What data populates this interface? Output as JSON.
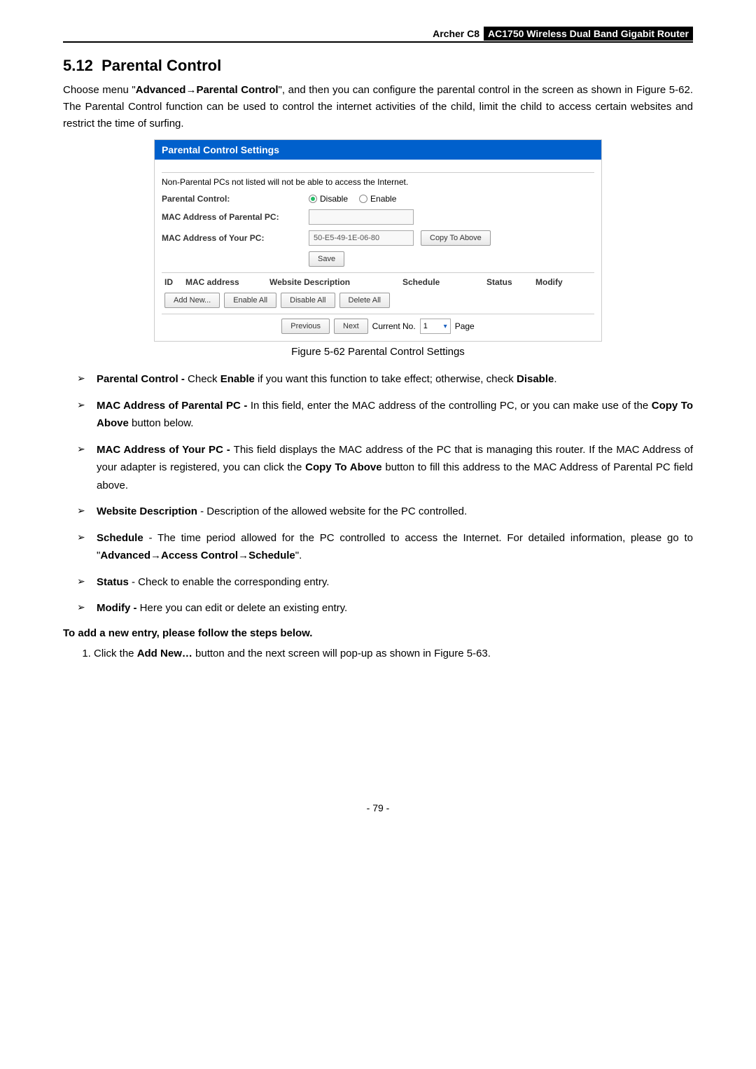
{
  "header": {
    "model": "Archer C8",
    "desc": "AC1750 Wireless Dual Band Gigabit Router"
  },
  "section": {
    "number": "5.12",
    "title": "Parental Control"
  },
  "intro": {
    "pre": "Choose menu \"",
    "b1": "Advanced",
    "arrow": "→",
    "b2": "Parental Control",
    "post": "\", and then you can configure the parental control in the screen as shown in Figure 5-62. The Parental Control function can be used to control the internet activities of the child, limit the child to access certain websites and restrict the time of surfing."
  },
  "ui": {
    "panel_title": "Parental Control Settings",
    "note": "Non-Parental PCs not listed will not be able to access the Internet.",
    "labels": {
      "parental_control": "Parental Control:",
      "mac_parental": "MAC Address of Parental PC:",
      "mac_your": "MAC Address of Your PC:"
    },
    "radio": {
      "disable": "Disable",
      "enable": "Enable"
    },
    "mac_your_value": "50-E5-49-1E-06-80",
    "buttons": {
      "copy": "Copy To Above",
      "save": "Save",
      "add": "Add New...",
      "enable_all": "Enable All",
      "disable_all": "Disable All",
      "delete_all": "Delete All",
      "previous": "Previous",
      "next": "Next"
    },
    "table": {
      "id": "ID",
      "mac": "MAC address",
      "web": "Website Description",
      "schedule": "Schedule",
      "status": "Status",
      "modify": "Modify"
    },
    "pager": {
      "current_no": "Current No.",
      "value": "1",
      "page": "Page"
    }
  },
  "caption": "Figure 5-62 Parental Control Settings",
  "bullets": {
    "b1": {
      "t1": "Parental Control - ",
      "t2": "Check ",
      "t3": "Enable",
      "t4": " if you want this function to take effect; otherwise, check ",
      "t5": "Disable",
      "t6": "."
    },
    "b2": {
      "t1": "MAC Address of Parental PC - ",
      "t2": "In this field, enter the MAC address of the controlling PC, or you can make use of the ",
      "t3": "Copy To Above",
      "t4": " button below."
    },
    "b3": {
      "t1": "MAC Address of Your PC - ",
      "t2": "This field displays the MAC address of the PC that is managing this router. If the MAC Address of your adapter is registered, you can click the ",
      "t3": "Copy To Above",
      "t4": " button to fill this address to the MAC Address of Parental PC field above."
    },
    "b4": {
      "t1": "Website Description",
      "t2": " - Description of the allowed website for the PC controlled."
    },
    "b5": {
      "t1": "Schedule",
      "t2": " - The time period allowed for the PC controlled to access the Internet. For detailed information, please go to \"",
      "t3": "Advanced",
      "t4": "→",
      "t5": "Access Control",
      "t6": "→",
      "t7": "Schedule",
      "t8": "\"."
    },
    "b6": {
      "t1": "Status",
      "t2": " - Check to enable the corresponding entry."
    },
    "b7": {
      "t1": "Modify -",
      "t2": " Here you can edit or delete an existing entry."
    }
  },
  "subhead": "To add a new entry, please follow the steps below.",
  "step1": {
    "t1": "Click the ",
    "t2": "Add New…",
    "t3": " button and the next screen will pop-up as shown in Figure 5-63."
  },
  "page_number": "- 79 -"
}
